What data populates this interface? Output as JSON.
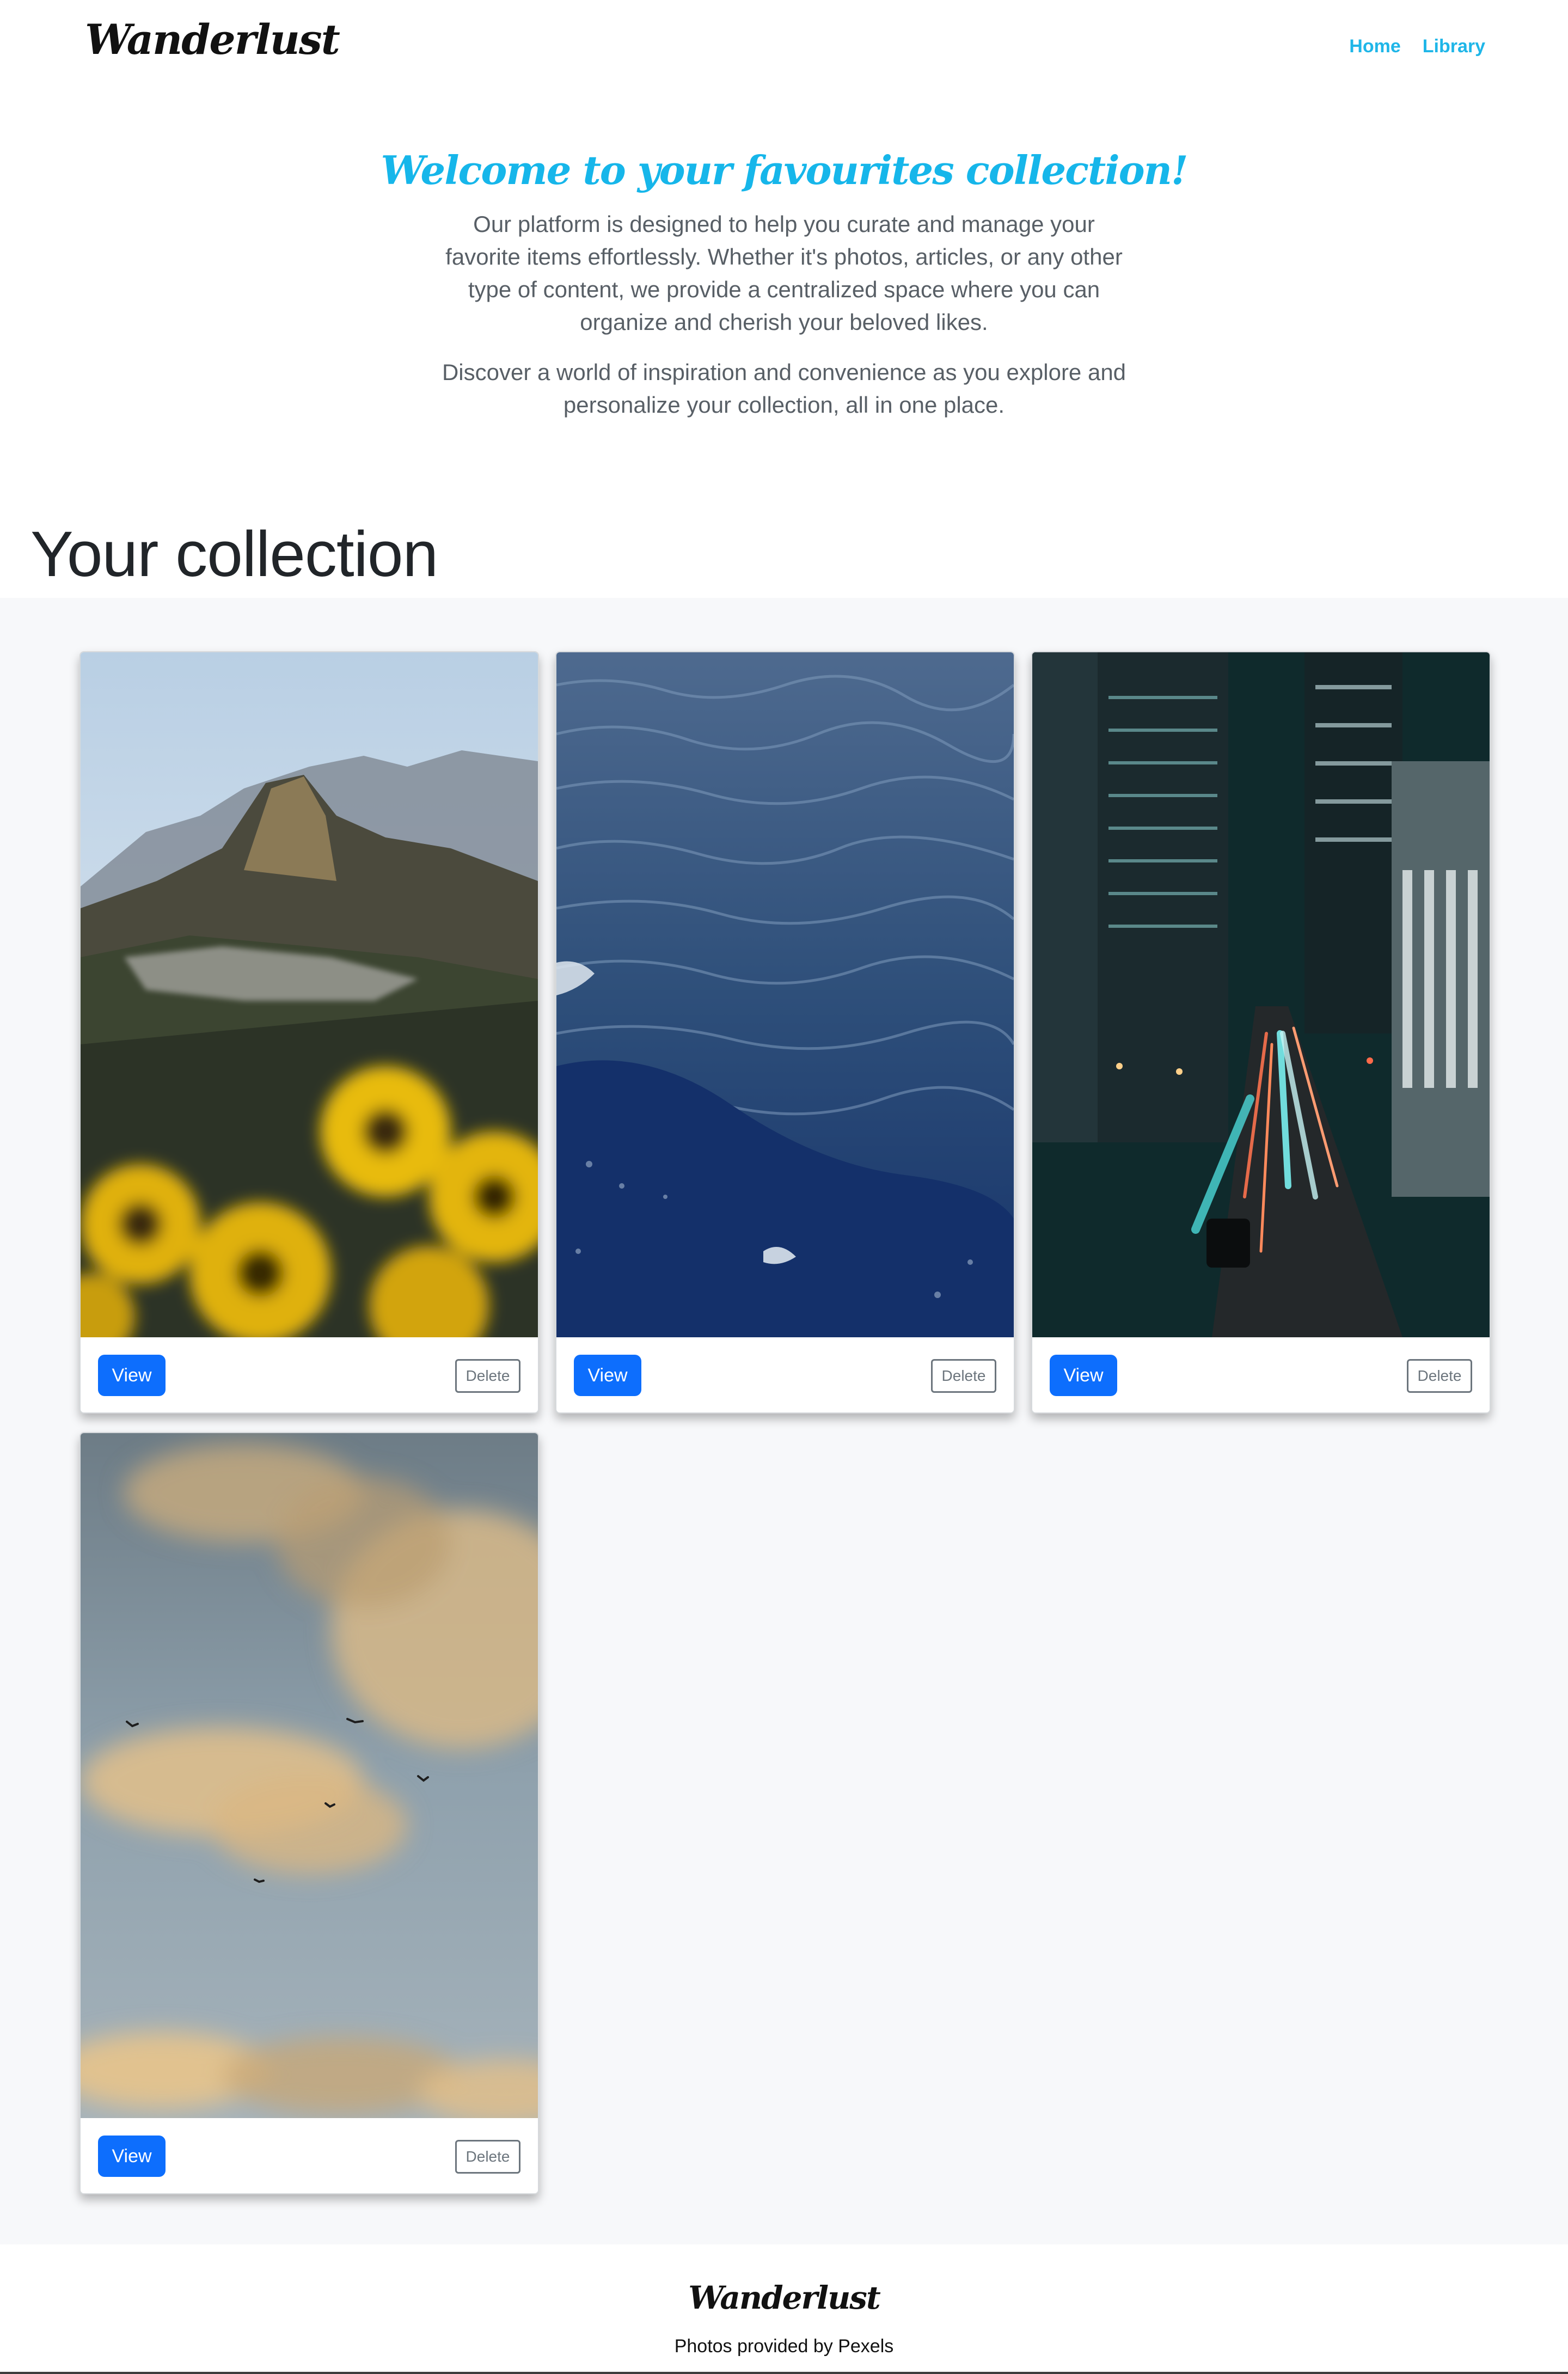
{
  "header": {
    "brand": "Wanderlust",
    "nav": [
      {
        "label": "Home"
      },
      {
        "label": "Library"
      }
    ],
    "accent_color": "#1fb6e8"
  },
  "hero": {
    "title": "Welcome to your favourites collection!",
    "paragraph1": "Our platform is designed to help you curate and manage your favorite items effortlessly. Whether it's photos, articles, or any other type of content, we provide a centralized space where you can organize and cherish your beloved likes.",
    "paragraph2": "Discover a world of inspiration and convenience as you explore and personalize your collection, all in one place."
  },
  "collection": {
    "title": "Your collection",
    "cards": [
      {
        "photo": "machu-picchu-mountain-with-yellow-flowers",
        "view_label": "View",
        "delete_label": "Delete"
      },
      {
        "photo": "deep-blue-ocean-waves",
        "view_label": "View",
        "delete_label": "Delete"
      },
      {
        "photo": "city-street-at-night-light-trails",
        "view_label": "View",
        "delete_label": "Delete"
      },
      {
        "photo": "sky-with-clouds-and-birds",
        "view_label": "View",
        "delete_label": "Delete"
      }
    ]
  },
  "footer": {
    "brand": "Wanderlust",
    "credit": "Photos provided by Pexels"
  },
  "colors": {
    "primary_button": "#0d6efd",
    "secondary_outline": "#6c757d",
    "collection_background": "#f7f8fa"
  }
}
